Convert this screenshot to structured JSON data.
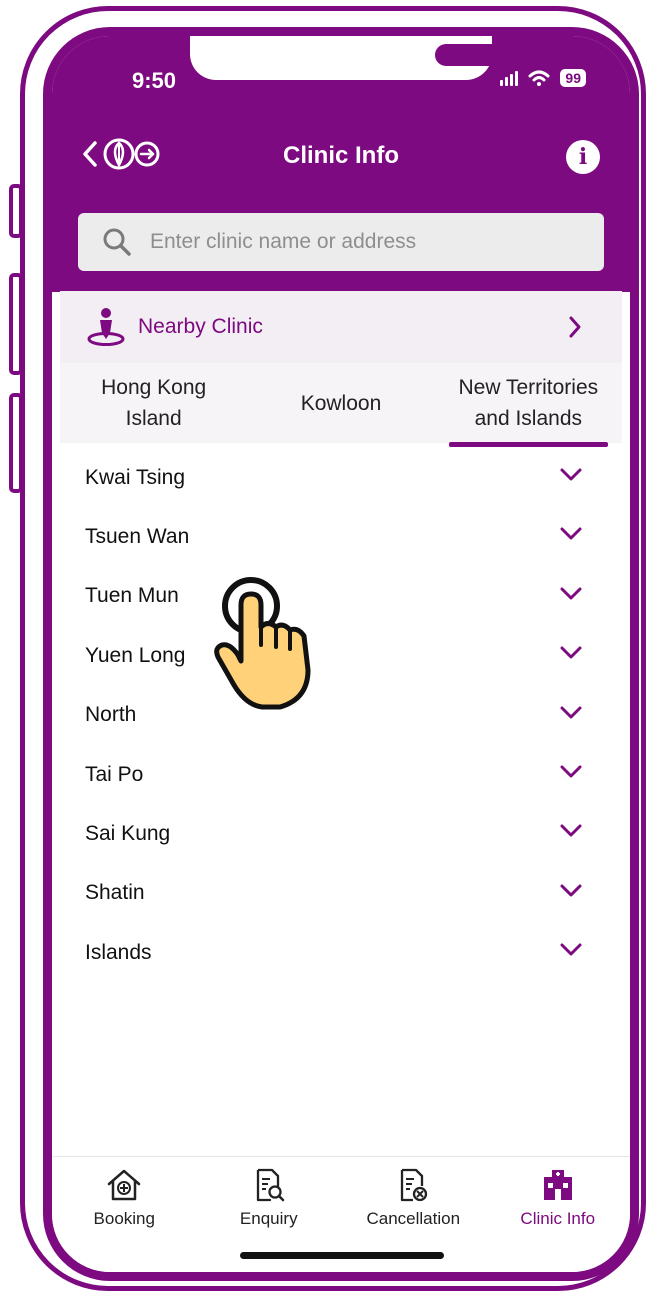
{
  "status_bar": {
    "time": "9:50",
    "battery": "99"
  },
  "header": {
    "title": "Clinic Info",
    "info_label": "i"
  },
  "search": {
    "placeholder": "Enter clinic name or address"
  },
  "nearby": {
    "label": "Nearby Clinic"
  },
  "tabs": [
    {
      "label": "Hong Kong Island",
      "active": false
    },
    {
      "label": "Kowloon",
      "active": false
    },
    {
      "label": "New Territories and Islands",
      "active": true
    }
  ],
  "districts": [
    "Kwai Tsing",
    "Tsuen Wan",
    "Tuen Mun",
    "Yuen Long",
    "North",
    "Tai Po",
    "Sai Kung",
    "Shatin",
    "Islands"
  ],
  "bottom_nav": [
    {
      "label": "Booking",
      "icon": "booking-house-icon"
    },
    {
      "label": "Enquiry",
      "icon": "enquiry-doc-icon"
    },
    {
      "label": "Cancellation",
      "icon": "cancellation-doc-icon"
    },
    {
      "label": "Clinic Info",
      "icon": "clinic-info-icon",
      "active": true
    }
  ],
  "colors": {
    "brand": "#7d0a80",
    "tab_bg": "#f7f4f8",
    "nearby_bg": "#f3eef4"
  }
}
